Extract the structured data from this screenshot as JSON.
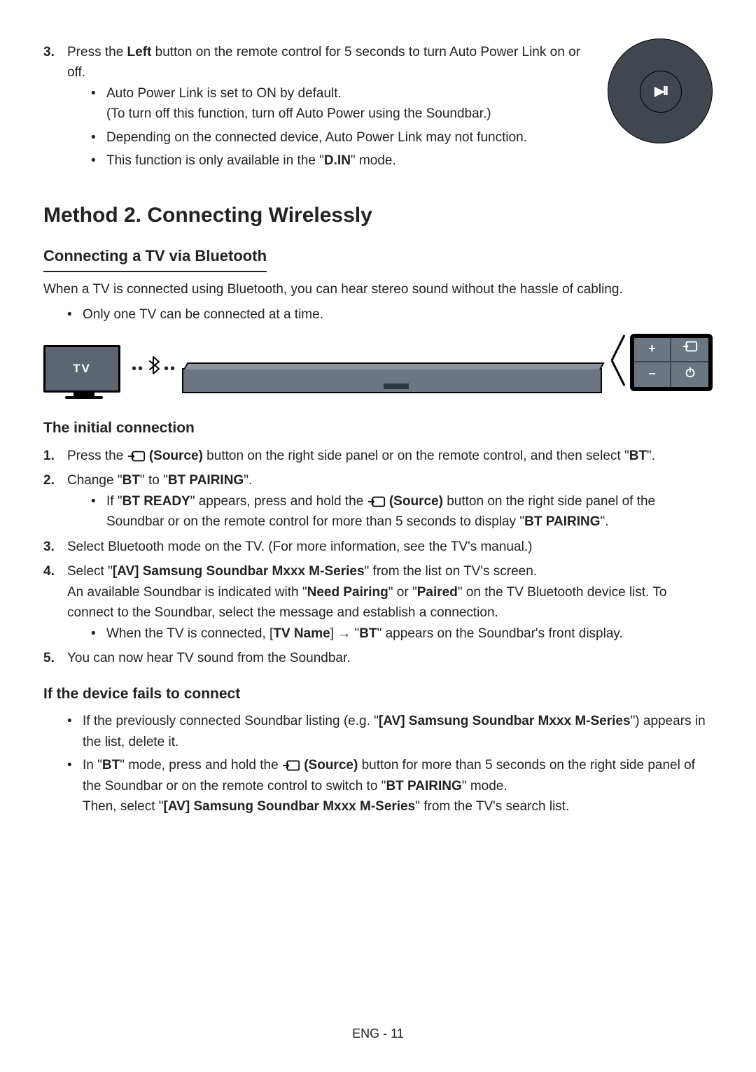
{
  "step3": {
    "num": "3.",
    "text_a": "Press the ",
    "left": "Left",
    "text_b": " button on the remote control for 5 seconds to turn Auto Power Link on or off.",
    "bullets": [
      {
        "line": "Auto Power Link is set to ON by default.",
        "note": "(To turn off this function, turn off Auto Power using the Soundbar.)"
      },
      {
        "line": "Depending on the connected device, Auto Power Link may not function."
      },
      {
        "pre": "This function is only available in the \"",
        "bold": "D.IN",
        "post": "\" mode."
      }
    ]
  },
  "remote": {
    "play_label": "▶II"
  },
  "h2": "Method 2. Connecting Wirelessly",
  "h3a": "Connecting a TV via Bluetooth",
  "intro": "When a TV is connected using Bluetooth, you can hear stereo sound without the hassle of cabling.",
  "intro_bullet": "Only one TV can be connected at a time.",
  "diagram": {
    "tv_label": "TV",
    "bt_left": "••",
    "bt_right": "••",
    "panel": {
      "plus": "+",
      "minus": "−",
      "source": "⇥",
      "power": "⏻"
    }
  },
  "h3b": "The initial connection",
  "steps": {
    "s1": {
      "num": "1.",
      "pre": "Press the ",
      "src_label": " (Source)",
      "mid": " button on the right side panel or on the remote control, and then select \"",
      "bt": "BT",
      "post": "\"."
    },
    "s2": {
      "num": "2.",
      "pre": "Change \"",
      "bt": "BT",
      "mid": "\" to \"",
      "pairing": "BT PAIRING",
      "post": "\".",
      "sub": {
        "pre": "If \"",
        "ready": "BT READY",
        "mid1": "\" appears, press and hold the ",
        "src_label": " (Source)",
        "mid2": " button on the right side panel of the Soundbar or on the remote control for more than 5 seconds to display \"",
        "pairing": "BT PAIRING",
        "post": "\"."
      }
    },
    "s3": {
      "num": "3.",
      "text": "Select Bluetooth mode on the TV. (For more information, see the TV's manual.)"
    },
    "s4": {
      "num": "4.",
      "pre": "Select \"",
      "name": "[AV] Samsung Soundbar Mxxx M-Series",
      "post": "\" from the list on TV's screen.",
      "line2a": "An available Soundbar is indicated with \"",
      "need": "Need Pairing",
      "line2b": "\" or \"",
      "paired": "Paired",
      "line2c": "\" on the TV Bluetooth device list. To connect to the Soundbar, select the message and establish a connection.",
      "sub_pre": "When the TV is connected, [",
      "tvname": "TV Name",
      "sub_mid": "] → \"",
      "bt": "BT",
      "sub_post": "\" appears on the Soundbar's front display."
    },
    "s5": {
      "num": "5.",
      "text": "You can now hear TV sound from the Soundbar."
    }
  },
  "h3c": "If the device fails to connect",
  "fail": {
    "b1": {
      "pre": "If the previously connected Soundbar listing (e.g. \"",
      "name": "[AV] Samsung Soundbar Mxxx M-Series",
      "post": "\") appears in the list, delete it."
    },
    "b2": {
      "pre": "In \"",
      "bt": "BT",
      "mid1": "\" mode, press and hold the ",
      "src_label": " (Source)",
      "mid2": " button for more than 5 seconds on the right side panel of the Soundbar or on the remote control to switch to \"",
      "pairing": "BT PAIRING",
      "mid3": "\" mode.",
      "then_pre": "Then, select \"",
      "name": "[AV] Samsung Soundbar Mxxx M-Series",
      "then_post": "\" from the TV's search list."
    }
  },
  "footer": "ENG - 11"
}
